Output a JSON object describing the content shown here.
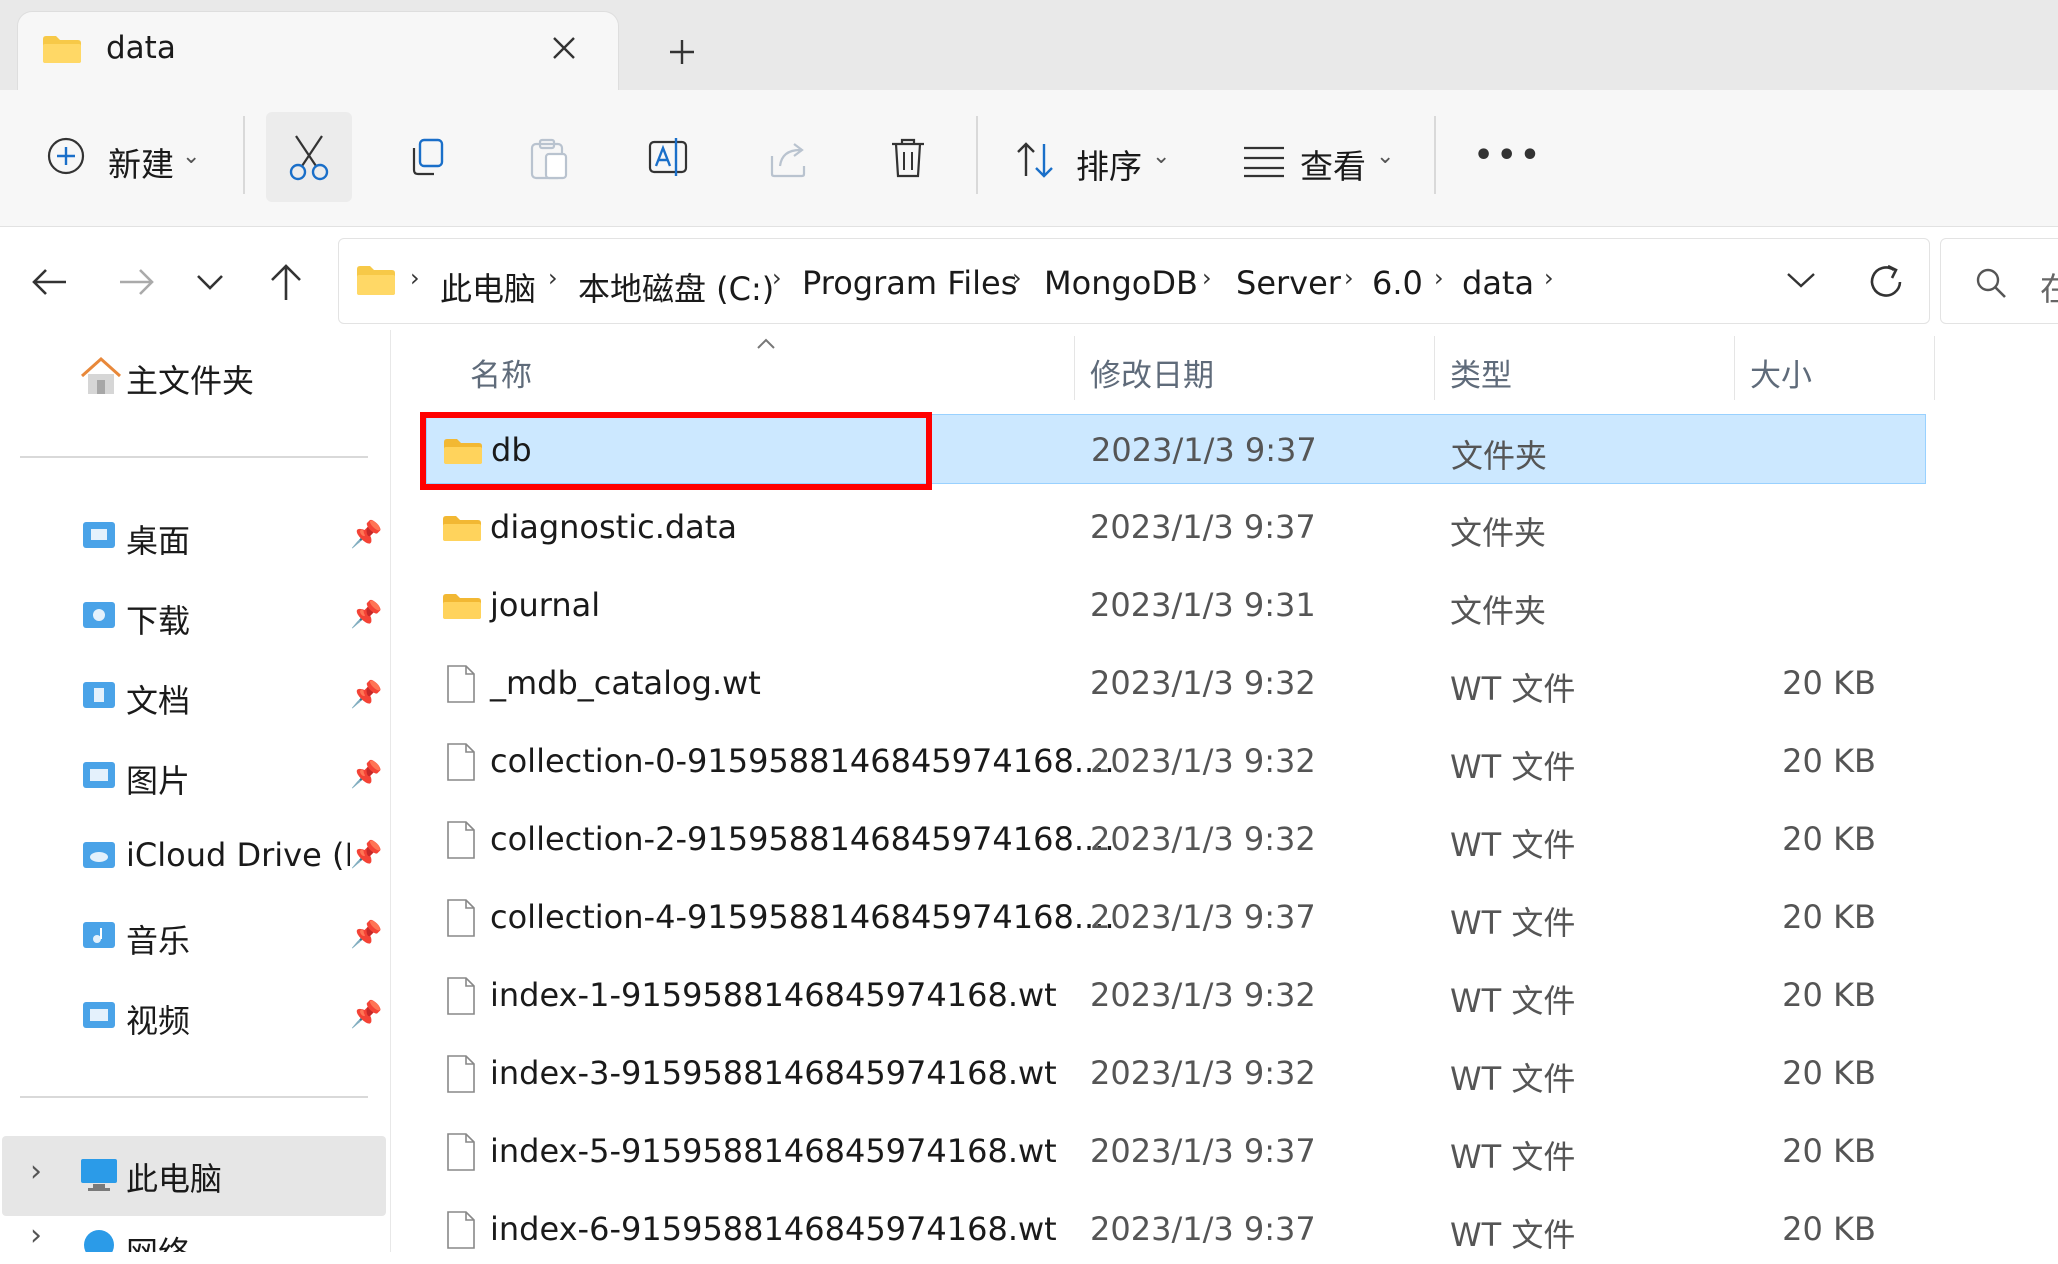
{
  "tab": {
    "title": "data",
    "close_icon": "close-icon",
    "new_tab_icon": "plus-icon"
  },
  "toolbar": {
    "new_label": "新建",
    "sort_label": "排序",
    "view_label": "查看",
    "more_label": "•••"
  },
  "breadcrumb": [
    "此电脑",
    "本地磁盘 (C:)",
    "Program Files",
    "MongoDB",
    "Server",
    "6.0",
    "data"
  ],
  "search": {
    "placeholder": "在"
  },
  "sidebar": {
    "home": "主文件夹",
    "quick": [
      {
        "label": "桌面"
      },
      {
        "label": "下载"
      },
      {
        "label": "文档"
      },
      {
        "label": "图片"
      },
      {
        "label": "iCloud Drive (M"
      },
      {
        "label": "音乐"
      },
      {
        "label": "视频"
      }
    ],
    "this_pc": "此电脑",
    "network": "网络"
  },
  "columns": {
    "name": "名称",
    "date": "修改日期",
    "type": "类型",
    "size": "大小"
  },
  "files": [
    {
      "name": "db",
      "date": "2023/1/3 9:37",
      "type": "文件夹",
      "size": "",
      "kind": "folder"
    },
    {
      "name": "diagnostic.data",
      "date": "2023/1/3 9:37",
      "type": "文件夹",
      "size": "",
      "kind": "folder"
    },
    {
      "name": "journal",
      "date": "2023/1/3 9:31",
      "type": "文件夹",
      "size": "",
      "kind": "folder"
    },
    {
      "name": "_mdb_catalog.wt",
      "date": "2023/1/3 9:32",
      "type": "WT 文件",
      "size": "20 KB",
      "kind": "file"
    },
    {
      "name": "collection-0-9159588146845974168....",
      "date": "2023/1/3 9:32",
      "type": "WT 文件",
      "size": "20 KB",
      "kind": "file"
    },
    {
      "name": "collection-2-9159588146845974168....",
      "date": "2023/1/3 9:32",
      "type": "WT 文件",
      "size": "20 KB",
      "kind": "file"
    },
    {
      "name": "collection-4-9159588146845974168....",
      "date": "2023/1/3 9:37",
      "type": "WT 文件",
      "size": "20 KB",
      "kind": "file"
    },
    {
      "name": "index-1-9159588146845974168.wt",
      "date": "2023/1/3 9:32",
      "type": "WT 文件",
      "size": "20 KB",
      "kind": "file"
    },
    {
      "name": "index-3-9159588146845974168.wt",
      "date": "2023/1/3 9:32",
      "type": "WT 文件",
      "size": "20 KB",
      "kind": "file"
    },
    {
      "name": "index-5-9159588146845974168.wt",
      "date": "2023/1/3 9:37",
      "type": "WT 文件",
      "size": "20 KB",
      "kind": "file"
    },
    {
      "name": "index-6-9159588146845974168.wt",
      "date": "2023/1/3 9:37",
      "type": "WT 文件",
      "size": "20 KB",
      "kind": "file"
    }
  ],
  "colors": {
    "selection": "#cce8ff",
    "highlight_box": "#ff0000",
    "folder": "#f7c948"
  }
}
